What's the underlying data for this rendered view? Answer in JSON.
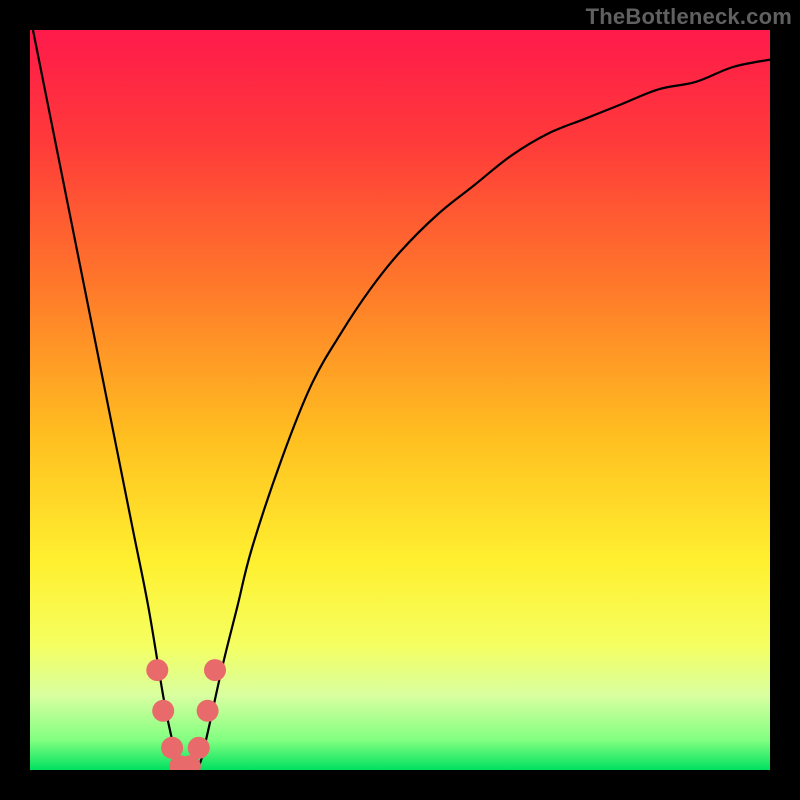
{
  "watermark": "TheBottleneck.com",
  "chart_data": {
    "type": "line",
    "title": "",
    "xlabel": "",
    "ylabel": "",
    "xlim": [
      0,
      100
    ],
    "ylim": [
      0,
      100
    ],
    "series": [
      {
        "name": "curve",
        "x": [
          0,
          2,
          4,
          6,
          8,
          10,
          12,
          14,
          16,
          18,
          19,
          20,
          21,
          22,
          23,
          24,
          26,
          28,
          30,
          34,
          38,
          42,
          46,
          50,
          55,
          60,
          65,
          70,
          75,
          80,
          85,
          90,
          95,
          100
        ],
        "y": [
          102,
          92,
          82,
          72,
          62,
          52,
          42,
          32,
          22,
          10,
          5,
          1,
          0,
          0,
          1,
          5,
          14,
          22,
          30,
          42,
          52,
          59,
          65,
          70,
          75,
          79,
          83,
          86,
          88,
          90,
          92,
          93,
          95,
          96
        ]
      }
    ],
    "markers": {
      "name": "dots",
      "color": "#e86a6a",
      "points": [
        {
          "x": 17.2,
          "y": 13.5
        },
        {
          "x": 18.0,
          "y": 8.0
        },
        {
          "x": 19.2,
          "y": 3.0
        },
        {
          "x": 20.3,
          "y": 0.5
        },
        {
          "x": 21.6,
          "y": 0.5
        },
        {
          "x": 22.8,
          "y": 3.0
        },
        {
          "x": 24.0,
          "y": 8.0
        },
        {
          "x": 25.0,
          "y": 13.5
        }
      ]
    },
    "background_gradient": {
      "stops": [
        {
          "offset": 0.0,
          "color": "#ff1a4b"
        },
        {
          "offset": 0.15,
          "color": "#ff3a3a"
        },
        {
          "offset": 0.35,
          "color": "#ff7a2a"
        },
        {
          "offset": 0.55,
          "color": "#ffbf20"
        },
        {
          "offset": 0.72,
          "color": "#fff030"
        },
        {
          "offset": 0.83,
          "color": "#f5ff60"
        },
        {
          "offset": 0.9,
          "color": "#d8ffa0"
        },
        {
          "offset": 0.96,
          "color": "#80ff80"
        },
        {
          "offset": 1.0,
          "color": "#00e060"
        }
      ]
    }
  }
}
